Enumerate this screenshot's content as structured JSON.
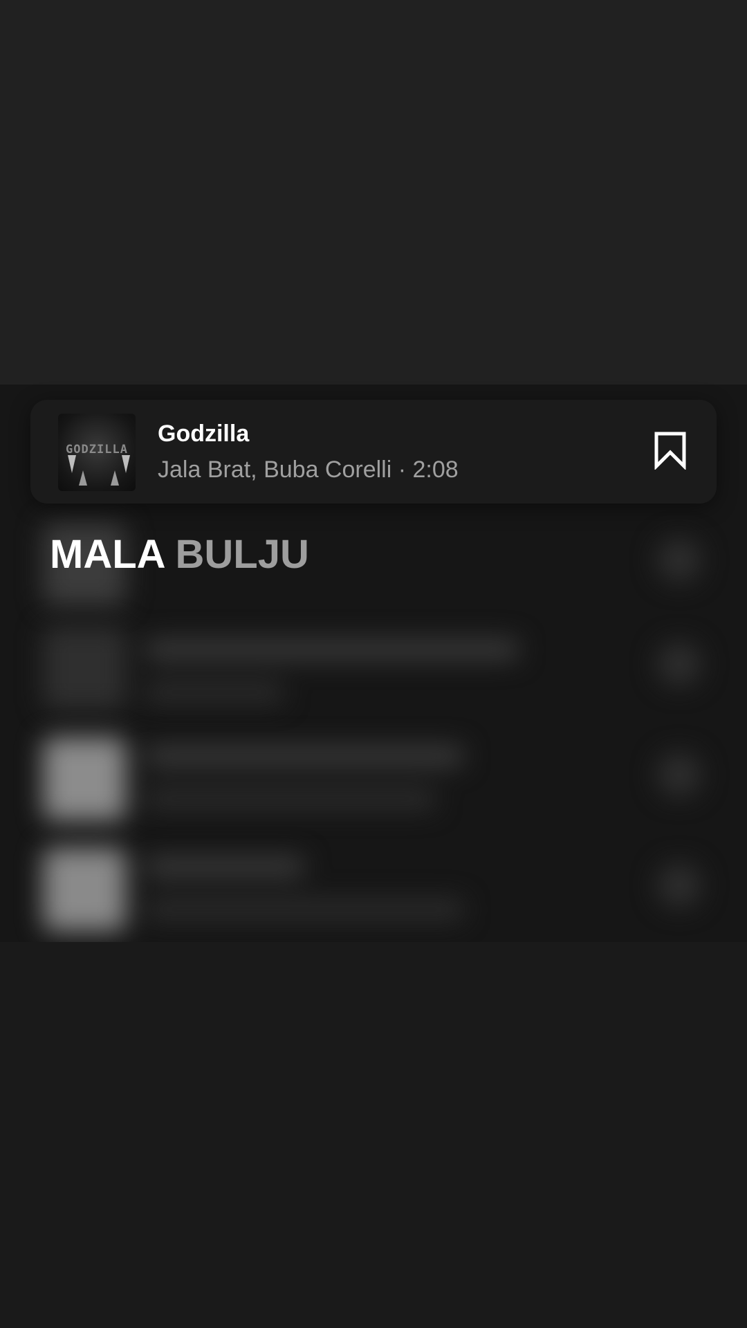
{
  "track": {
    "title": "Godzilla",
    "subtitle": "Jala Brat, Buba Corelli · 2:08",
    "cover_text": "GODZILLA"
  },
  "section": {
    "heading_primary": "MALA",
    "heading_secondary": "BULJU"
  },
  "icons": {
    "save": "bookmark-icon"
  },
  "colors": {
    "background": "#1a1a1a",
    "card": "#1b1b1b",
    "title": "#ffffff",
    "subtitle": "#a0a0a0",
    "heading_dim": "#9e9e9e"
  }
}
